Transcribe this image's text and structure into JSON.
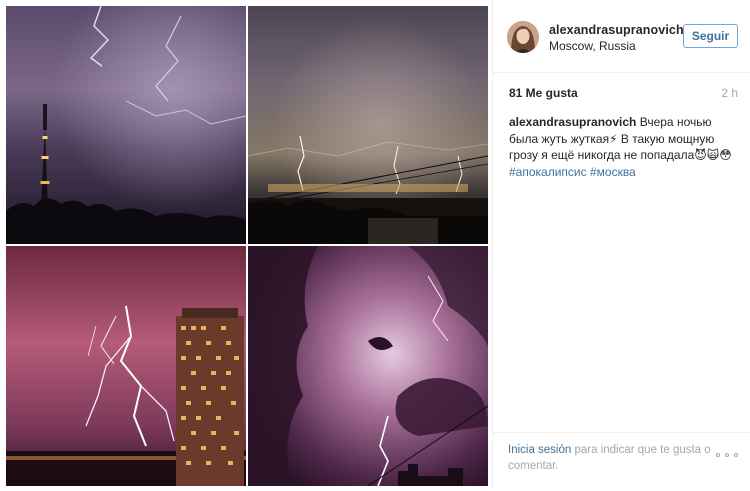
{
  "post": {
    "images": [
      {
        "icon": "storm-tower-photo"
      },
      {
        "icon": "storm-cityscape-photo"
      },
      {
        "icon": "lightning-building-photo"
      },
      {
        "icon": "purple-storm-clouds-photo"
      }
    ]
  },
  "header": {
    "username": "alexandrasupranovich",
    "location": "Moscow, Russia",
    "follow_label": "Seguir"
  },
  "stats": {
    "likes": "81 Me gusta",
    "time": "2 h"
  },
  "caption": {
    "username": "alexandrasupranovich",
    "text": " Вчера ночью была жуть жуткая⚡ В такую мощную грозу я ещё никогда не попадала😈🙀😳",
    "tag1": "#апокалипсис",
    "tag2": "#москва"
  },
  "footer": {
    "login_link": "Inicia sesión",
    "login_text": " para indicar que te gusta o comentar."
  },
  "colors": {
    "link": "#3f729b",
    "muted": "#a5a7aa",
    "border": "#efefef"
  }
}
